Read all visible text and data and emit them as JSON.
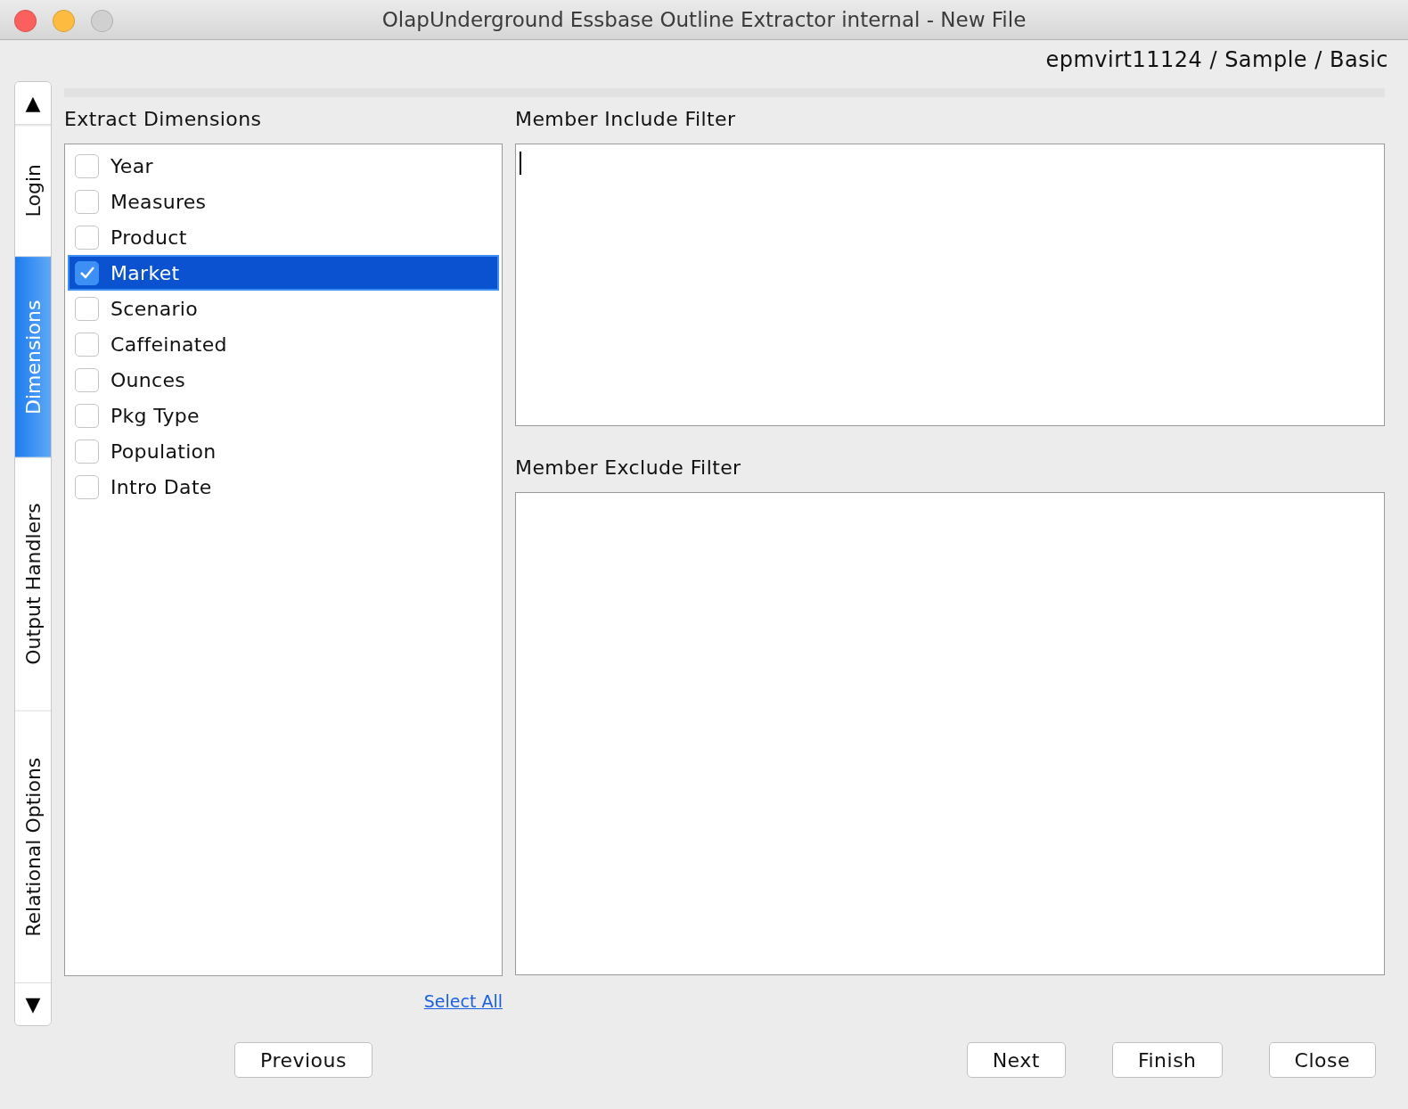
{
  "window": {
    "title": "OlapUnderground Essbase Outline Extractor internal - New File"
  },
  "connection": "epmvirt11124 / Sample / Basic",
  "tab_scroll": {
    "up": "▲",
    "down": "▼"
  },
  "tabs": [
    {
      "label": "Login",
      "selected": false
    },
    {
      "label": "Dimensions",
      "selected": true
    },
    {
      "label": "Output Handlers",
      "selected": false
    },
    {
      "label": "Relational Options",
      "selected": false
    }
  ],
  "dimensions": {
    "title": "Extract Dimensions",
    "items": [
      {
        "label": "Year",
        "checked": false,
        "selected": false
      },
      {
        "label": "Measures",
        "checked": false,
        "selected": false
      },
      {
        "label": "Product",
        "checked": false,
        "selected": false
      },
      {
        "label": "Market",
        "checked": true,
        "selected": true
      },
      {
        "label": "Scenario",
        "checked": false,
        "selected": false
      },
      {
        "label": "Caffeinated",
        "checked": false,
        "selected": false
      },
      {
        "label": "Ounces",
        "checked": false,
        "selected": false
      },
      {
        "label": "Pkg Type",
        "checked": false,
        "selected": false
      },
      {
        "label": "Population",
        "checked": false,
        "selected": false
      },
      {
        "label": "Intro Date",
        "checked": false,
        "selected": false
      }
    ],
    "select_all": "Select All"
  },
  "include_filter": {
    "title": "Member Include Filter",
    "focused": true
  },
  "exclude_filter": {
    "title": "Member Exclude Filter",
    "focused": false
  },
  "left_buttons": [
    "Previous"
  ],
  "right_buttons": [
    "Next",
    "Finish",
    "Close"
  ]
}
